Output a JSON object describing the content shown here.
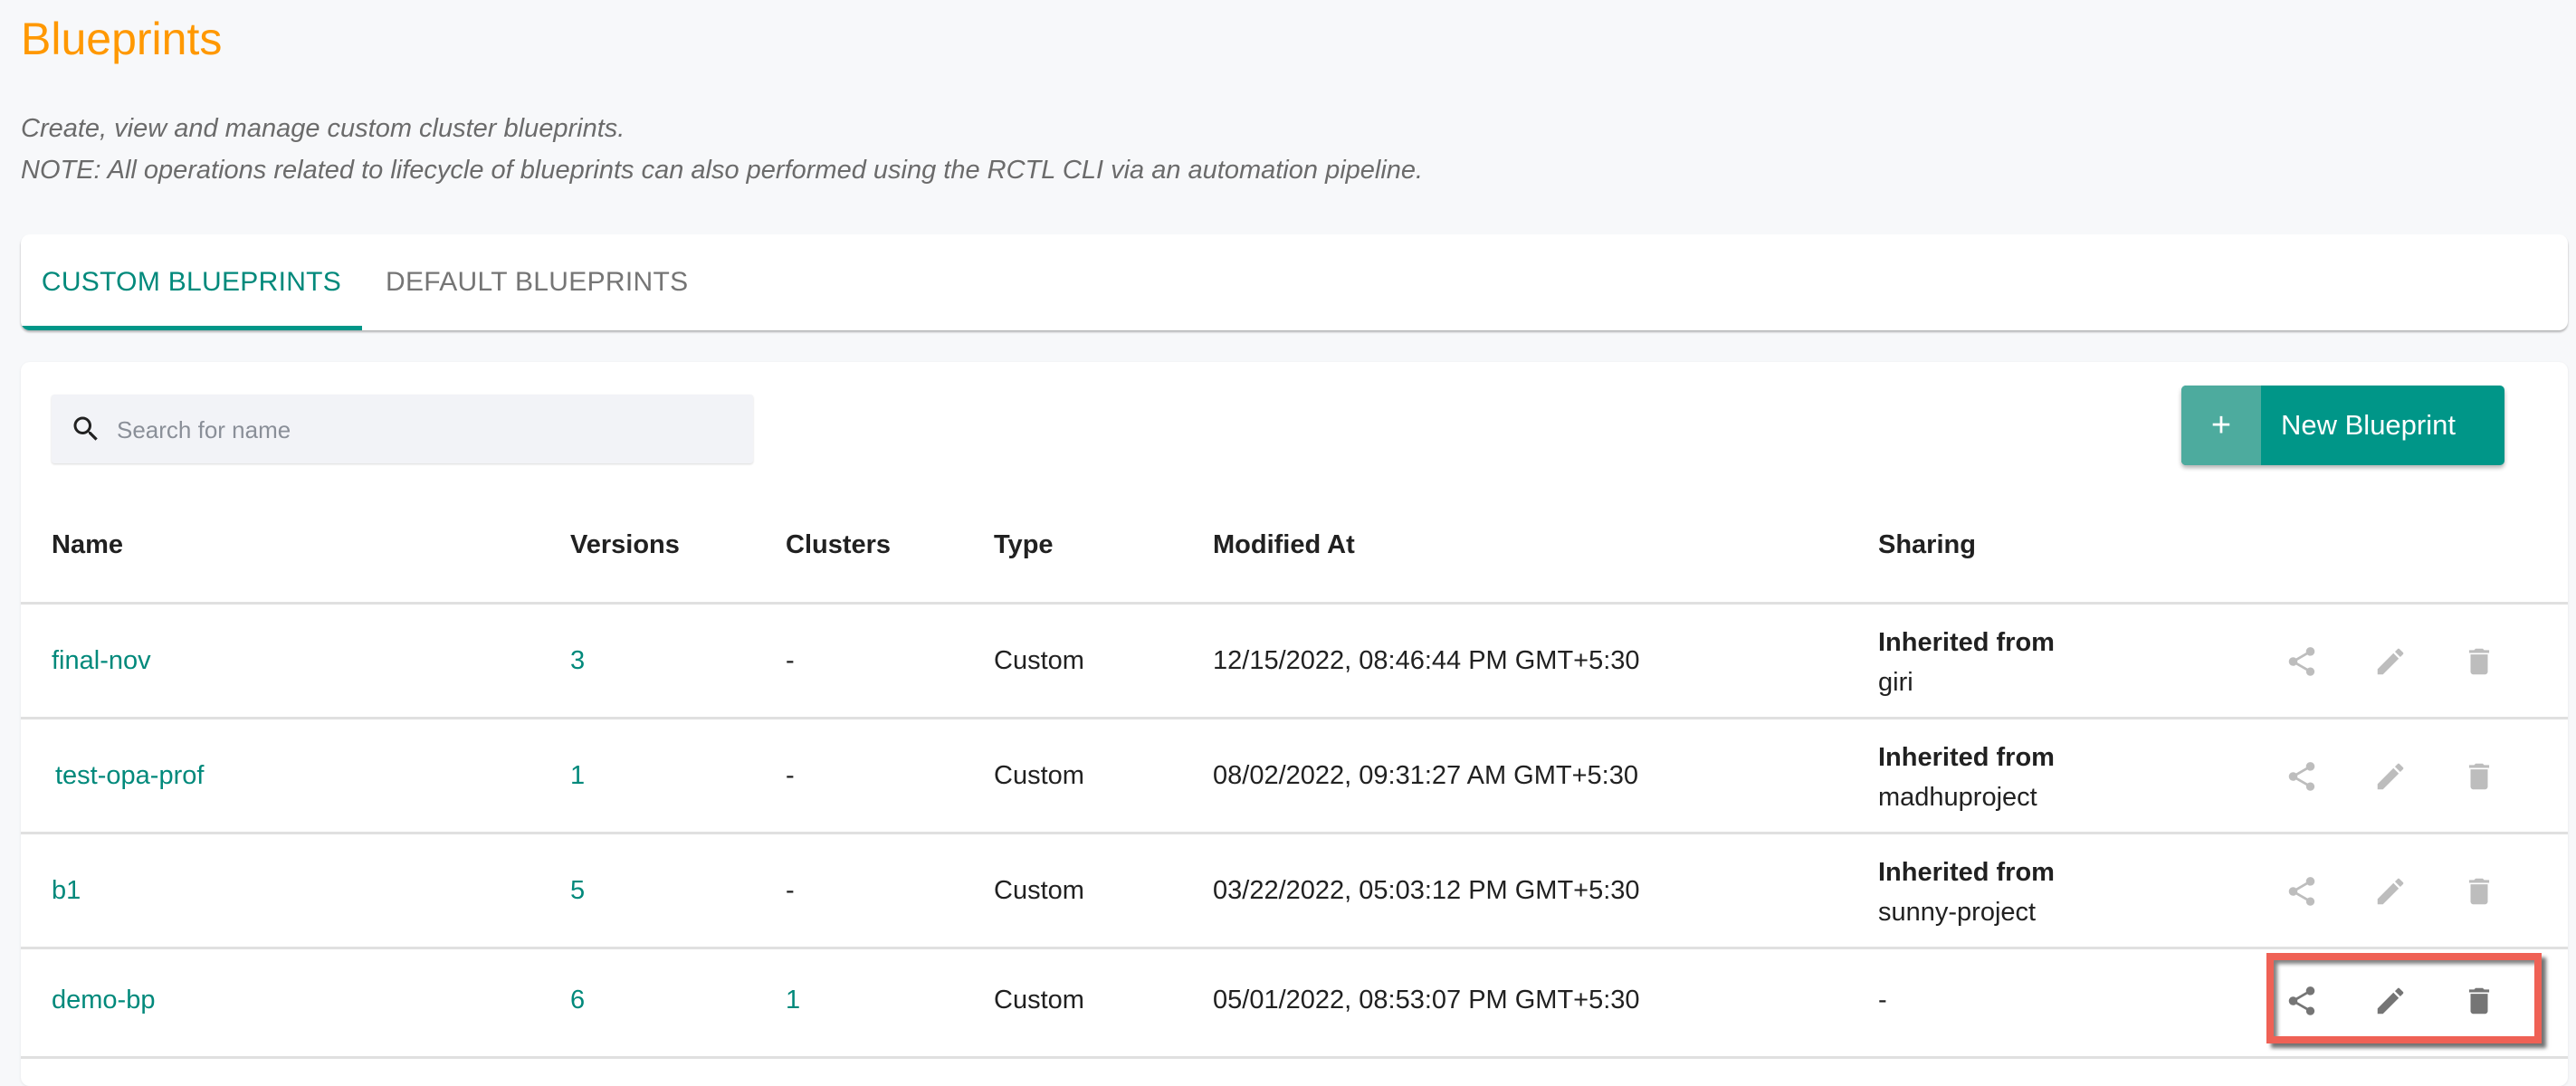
{
  "page": {
    "title": "Blueprints",
    "description": "Create, view and manage custom cluster blueprints.",
    "note": "NOTE: All operations related to lifecycle of blueprints can also performed using the RCTL CLI via an automation pipeline."
  },
  "tabs": [
    {
      "label": "CUSTOM BLUEPRINTS",
      "active": true
    },
    {
      "label": "DEFAULT BLUEPRINTS",
      "active": false
    }
  ],
  "toolbar": {
    "search_placeholder": "Search for name",
    "search_value": "",
    "new_button_icon": "+",
    "new_button_label": "New Blueprint"
  },
  "table": {
    "columns": [
      "Name",
      "Versions",
      "Clusters",
      "Type",
      "Modified At",
      "Sharing"
    ],
    "rows": [
      {
        "name": "final-nov",
        "versions": "3",
        "clusters": "-",
        "type": "Custom",
        "modified_at": "12/15/2022, 08:46:44 PM GMT+5:30",
        "sharing_label": "Inherited from",
        "sharing_project": "giri",
        "actions_enabled": false
      },
      {
        "name": "test-opa-prof",
        "versions": "1",
        "clusters": "-",
        "type": "Custom",
        "modified_at": "08/02/2022, 09:31:27 AM GMT+5:30",
        "sharing_label": "Inherited from",
        "sharing_project": "madhuproject",
        "actions_enabled": false
      },
      {
        "name": "b1",
        "versions": "5",
        "clusters": "-",
        "type": "Custom",
        "modified_at": "03/22/2022, 05:03:12 PM GMT+5:30",
        "sharing_label": "Inherited from",
        "sharing_project": "sunny-project",
        "actions_enabled": false
      },
      {
        "name": "demo-bp",
        "versions": "6",
        "clusters": "1",
        "type": "Custom",
        "modified_at": "05/01/2022, 08:53:07 PM GMT+5:30",
        "sharing": "-",
        "actions_enabled": true
      }
    ],
    "row_actions": [
      "share-icon",
      "edit-icon",
      "delete-icon"
    ]
  },
  "colors": {
    "title": "#ff9800",
    "accent": "#009688",
    "link": "#00897b",
    "highlight": "#ef6155",
    "icon_disabled": "#bdbdbd",
    "icon_enabled": "#757575"
  }
}
